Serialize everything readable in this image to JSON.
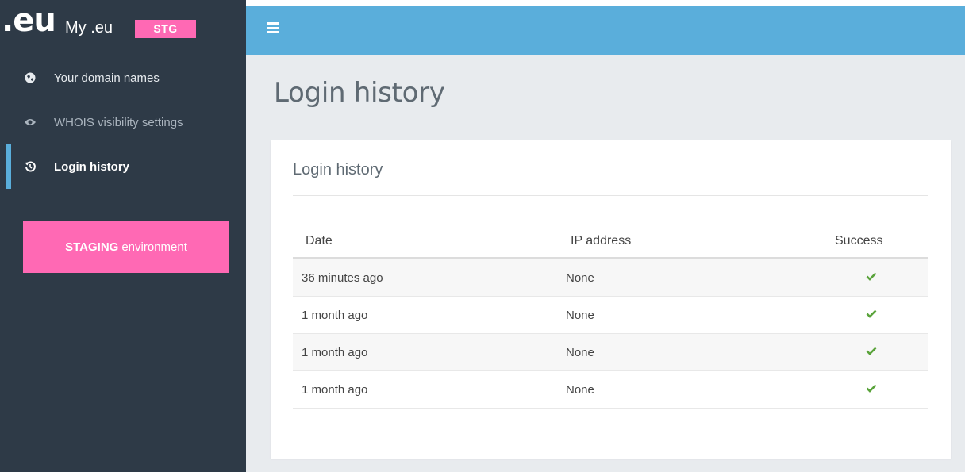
{
  "brand": {
    "logo": ".eu",
    "title": "My .eu",
    "badge": "STG"
  },
  "sidebar": {
    "items": [
      {
        "label": "Your domain names",
        "icon": "globe-icon"
      },
      {
        "label": "WHOIS visibility settings",
        "icon": "eye-icon"
      },
      {
        "label": "Login history",
        "icon": "history-icon",
        "active": true
      }
    ],
    "staging": {
      "bold": "STAGING",
      "rest": "environment"
    }
  },
  "topbar": {
    "menu_icon": "hamburger-menu-icon"
  },
  "main": {
    "page_title": "Login history",
    "card_title": "Login history",
    "table": {
      "headers": {
        "date": "Date",
        "ip": "IP address",
        "success": "Success"
      },
      "rows": [
        {
          "date": "36 minutes ago",
          "ip": "None",
          "success": true
        },
        {
          "date": "1 month ago",
          "ip": "None",
          "success": true
        },
        {
          "date": "1 month ago",
          "ip": "None",
          "success": true
        },
        {
          "date": "1 month ago",
          "ip": "None",
          "success": true
        }
      ]
    }
  },
  "colors": {
    "sidebar_bg": "#2e3a47",
    "topbar": "#5aaedb",
    "accent_pink": "#ff69b4",
    "check_green": "#5aa33b"
  }
}
